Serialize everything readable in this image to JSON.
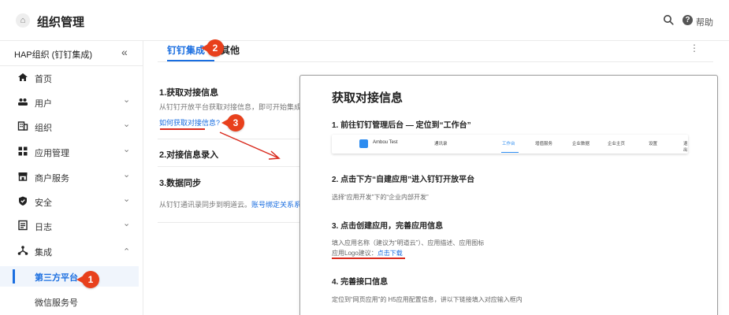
{
  "header": {
    "title": "组织管理",
    "help": "帮助"
  },
  "sidebar": {
    "org_name": "HAP组织 (钉钉集成)",
    "items": [
      {
        "label": "首页"
      },
      {
        "label": "用户"
      },
      {
        "label": "组织"
      },
      {
        "label": "应用管理"
      },
      {
        "label": "商户服务"
      },
      {
        "label": "安全"
      },
      {
        "label": "日志"
      },
      {
        "label": "集成"
      }
    ],
    "sub_items": [
      {
        "label": "第三方平台"
      },
      {
        "label": "微信服务号"
      }
    ]
  },
  "tabs": [
    {
      "label": "钉钉集成"
    },
    {
      "label": "其他"
    }
  ],
  "sections": {
    "s1_title": "1.获取对接信息",
    "s1_desc": "从钉钉开放平台获取对接信息，即可开始集成",
    "s1_link": "如何获取对接信息?",
    "s2_title": "2.对接信息录入",
    "s3_title": "3.数据同步",
    "s3_desc": "从钉钉通讯录同步到明道云。",
    "s3_link": "账号绑定关系系"
  },
  "badges": {
    "b1": "1",
    "b2": "2",
    "b3": "3"
  },
  "popup": {
    "title": "获取对接信息",
    "step1": "1. 前往钉钉管理后台 — 定位到“工作台”",
    "mock_nav": {
      "name": "Ambou Test",
      "items": [
        "通讯录",
        "工作台",
        "增值服务",
        "企业数据",
        "企业主页",
        "设置",
        "退出"
      ]
    },
    "step2": "2. 点击下方“自建应用”进入钉钉开放平台",
    "step2_text": "选择“应用开发”下的“企业内部开发”",
    "step3": "3. 点击创建应用，完善应用信息",
    "step3_text": "填入应用名称（建议为“明道云”）、应用描述、应用图标",
    "step3_logo": "应用Logo建议：",
    "step3_download": "点击下载",
    "step4": "4. 完善接口信息",
    "step4_text": "定位到“网页应用”的 H5应用配置信息，讲以下链接填入对应输入框内"
  },
  "colors": {
    "accent": "#1a6ee0",
    "badge": "#e8401c",
    "annotation": "#d9291c"
  }
}
